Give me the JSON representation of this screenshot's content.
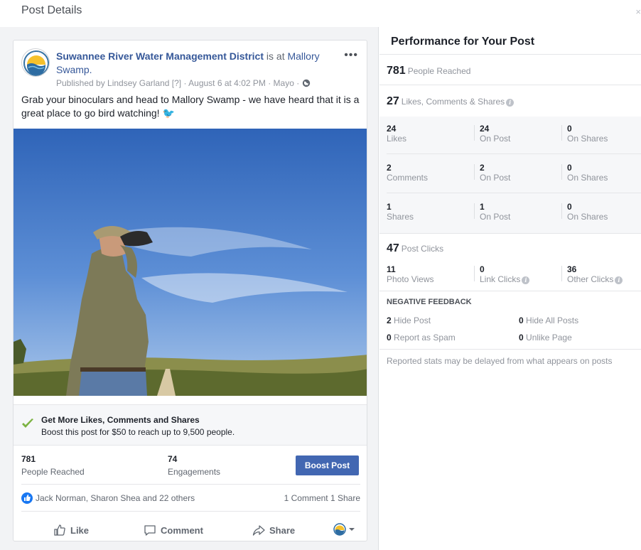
{
  "dialog": {
    "title": "Post Details",
    "close": "×"
  },
  "post": {
    "page_name": "Suwannee River Water Management District",
    "is_at": "is at",
    "location": "Mallory Swamp.",
    "byline": {
      "published_by": "Published by Lindsey Garland",
      "help": "[?]",
      "time": "· August 6 at 4:02 PM · Mayo ·"
    },
    "text": "Grab your binoculars and head to Mallory Swamp - we have heard that it is a great place to go bird watching! 🐦",
    "more": "•••"
  },
  "boost_panel": {
    "title": "Get More Likes, Comments and Shares",
    "subtitle": "Boost this post for $50 to reach up to 9,500 people."
  },
  "summary": {
    "reached_value": "781",
    "reached_label": "People Reached",
    "engagements_value": "74",
    "engagements_label": "Engagements",
    "boost_button": "Boost Post"
  },
  "social": {
    "reactors": "Jack Norman, Sharon Shea and 22 others",
    "counts": "1 Comment  1 Share"
  },
  "actions": {
    "like": "Like",
    "comment": "Comment",
    "share": "Share"
  },
  "performance": {
    "title": "Performance for Your Post",
    "reached": {
      "value": "781",
      "label": "People Reached"
    },
    "engagement": {
      "value": "27",
      "label": "Likes, Comments & Shares"
    },
    "rows": [
      {
        "total": "24",
        "total_label": "Likes",
        "on_post": "24",
        "on_post_label": "On Post",
        "on_shares": "0",
        "on_shares_label": "On Shares"
      },
      {
        "total": "2",
        "total_label": "Comments",
        "on_post": "2",
        "on_post_label": "On Post",
        "on_shares": "0",
        "on_shares_label": "On Shares"
      },
      {
        "total": "1",
        "total_label": "Shares",
        "on_post": "1",
        "on_post_label": "On Post",
        "on_shares": "0",
        "on_shares_label": "On Shares"
      }
    ],
    "clicks": {
      "value": "47",
      "label": "Post Clicks"
    },
    "click_breakdown": [
      {
        "value": "11",
        "label": "Photo Views"
      },
      {
        "value": "0",
        "label": "Link Clicks"
      },
      {
        "value": "36",
        "label": "Other Clicks"
      }
    ],
    "negative": {
      "heading": "NEGATIVE FEEDBACK",
      "hide_post": {
        "value": "2",
        "label": "Hide Post"
      },
      "hide_all": {
        "value": "0",
        "label": "Hide All Posts"
      },
      "spam": {
        "value": "0",
        "label": "Report as Spam"
      },
      "unlike": {
        "value": "0",
        "label": "Unlike Page"
      }
    },
    "footnote": "Reported stats may be delayed from what appears on posts"
  },
  "colors": {
    "link": "#365899",
    "boost": "#4267b2",
    "like_blue": "#1877f2",
    "check_green": "#7cb342"
  },
  "icons": [
    "page-logo-icon",
    "globe-icon",
    "check-icon",
    "like-reaction-icon",
    "thumbs-up-icon",
    "comment-icon",
    "share-icon",
    "page-avatar-selector-icon",
    "info-icon"
  ]
}
